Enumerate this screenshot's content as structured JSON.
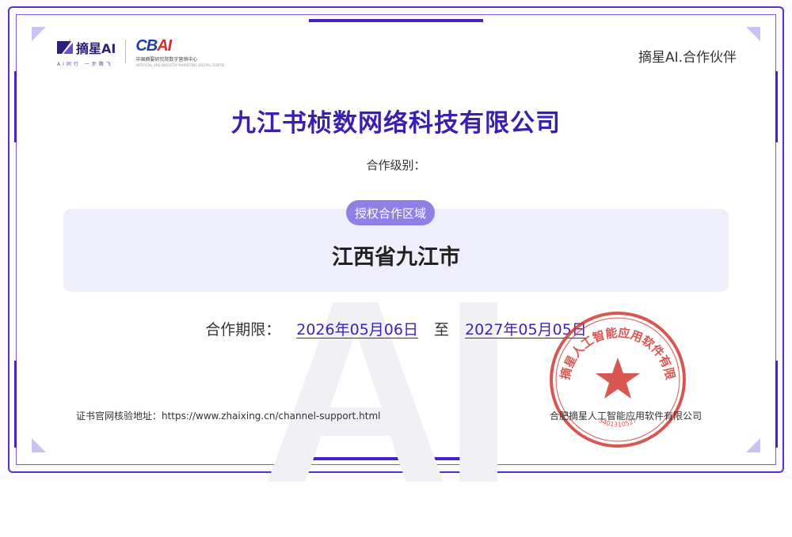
{
  "brand": {
    "zx_name": "摘星AI",
    "zx_tagline": "AI同行 一步腾飞",
    "cb_mark_main": "CB",
    "cb_mark_ai": "AI",
    "cb_sub": "中国摘要研究院数字营销中心",
    "cb_sub2": "ARTIFICIAL AND INDUSTRY MARKETING DIGITAL CENTRE"
  },
  "partner_tag": "摘星AI.合作伙伴",
  "company_name": "九江书桢数网络科技有限公司",
  "level_label": "合作级别：",
  "area": {
    "badge": "授权合作区域",
    "value": "江西省九江市"
  },
  "period": {
    "label": "合作期限：",
    "start": "2026年05月06日",
    "to": "至",
    "end": "2027年05月05日"
  },
  "verify_text": "证书官网核验地址：https://www.zhaixing.cn/channel-support.html",
  "issuer": "合肥摘星人工智能应用软件有限公司",
  "seal": {
    "text": "合肥摘星人工智能应用软件有限公司",
    "code": "3401310527",
    "color": "#d23a33"
  },
  "watermark": "AI",
  "colors": {
    "accent": "#4c1fc4",
    "title": "#3a1fb0",
    "pill": "#8f80e6"
  }
}
